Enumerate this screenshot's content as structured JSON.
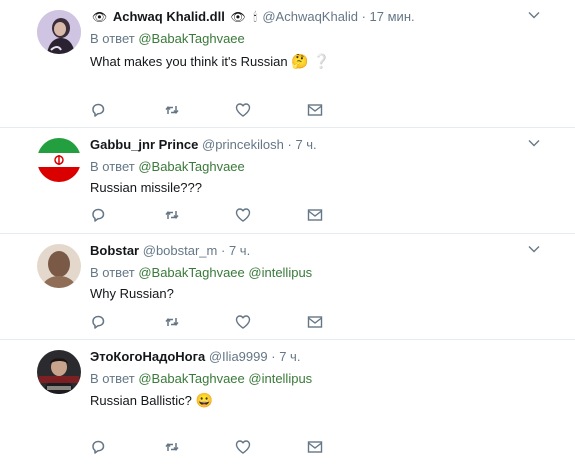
{
  "colors": {
    "link": "#3a7a3a",
    "muted": "#657786",
    "text": "#14171a",
    "divider": "#e6ecf0"
  },
  "tweets": [
    {
      "name": "Achwaq Khalid.dll",
      "prefix_emoji": "👁",
      "suffix_emoji1": "👁",
      "suffix_emoji2": "🕯",
      "handle": "@AchwaqKhalid",
      "dot": "·",
      "time": "17 мин.",
      "reply_prefix": "В ответ",
      "reply_to": [
        "@BabakTaghvaee"
      ],
      "text": "What makes you think it's Russian",
      "text_emoji": "🤔 ❔",
      "avatar_icon": "person-avatar-icon"
    },
    {
      "name": "Gabbu_jnr Prince",
      "handle": "@princekilosh",
      "dot": "·",
      "time": "7 ч.",
      "reply_prefix": "В ответ",
      "reply_to": [
        "@BabakTaghvaee"
      ],
      "text": "Russian missile???",
      "avatar_icon": "iran-flag-avatar-icon"
    },
    {
      "name": "Bobstar",
      "handle": "@bobstar_m",
      "dot": "·",
      "time": "7 ч.",
      "reply_prefix": "В ответ",
      "reply_to": [
        "@BabakTaghvaee",
        "@intellipus"
      ],
      "text": "Why Russian?",
      "avatar_icon": "default-egg-avatar-icon"
    },
    {
      "name": "ЭтоКогоНадоНога",
      "handle": "@Ilia9999",
      "dot": "·",
      "time": "7 ч.",
      "reply_prefix": "В ответ",
      "reply_to": [
        "@BabakTaghvaee",
        "@intellipus"
      ],
      "text": "Russian Ballistic?",
      "text_emoji": "😀",
      "avatar_icon": "poster-avatar-icon"
    }
  ]
}
